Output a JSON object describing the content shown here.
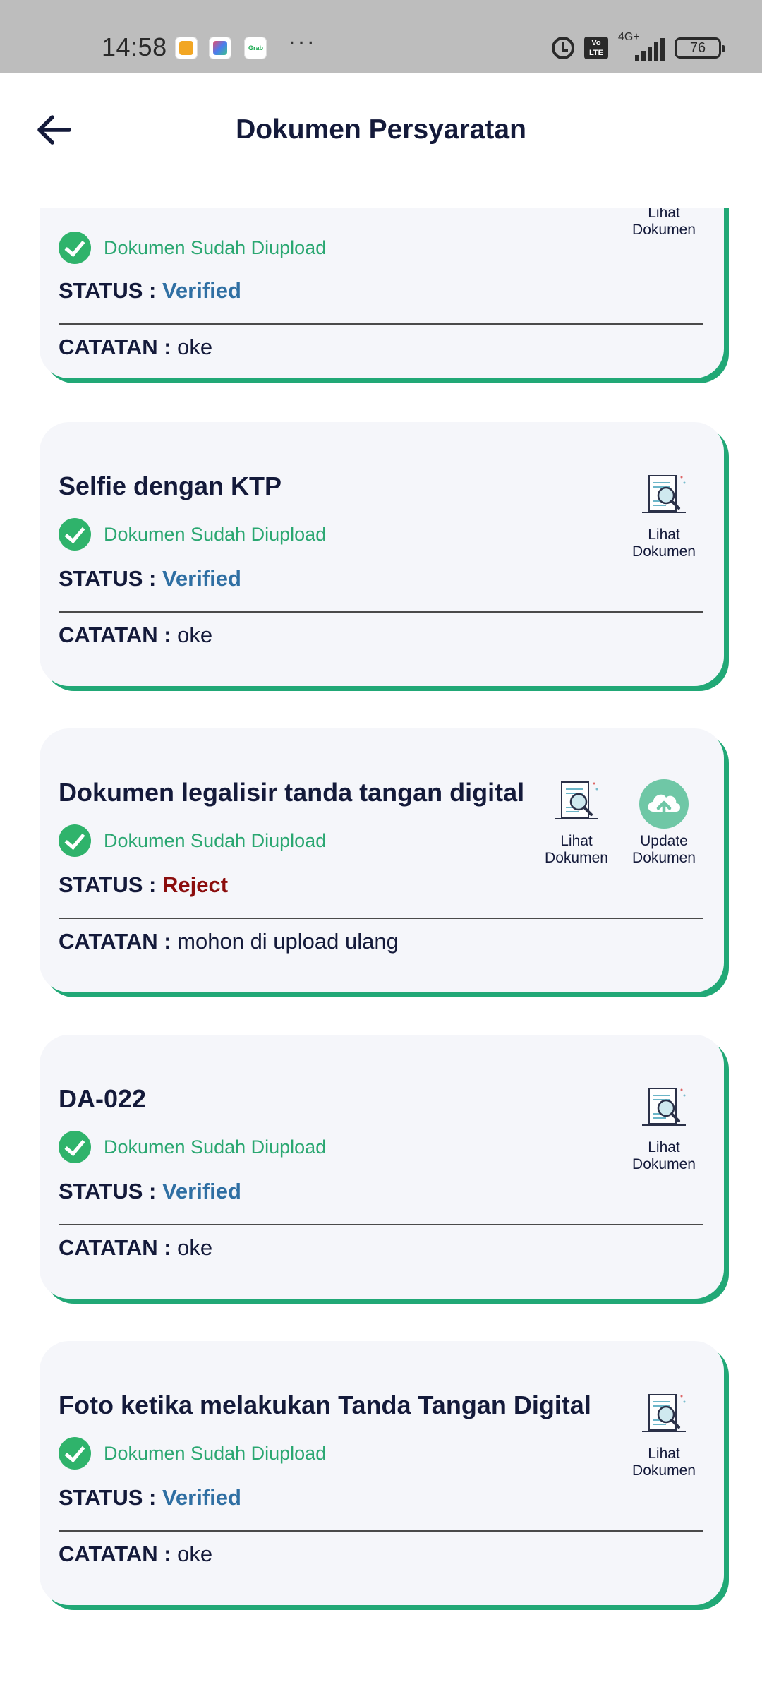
{
  "status_bar": {
    "time": "14:58",
    "network": "4G+",
    "volte": "Vo LTE",
    "battery": "76",
    "icons": [
      "shield-app-icon",
      "photo-app-icon",
      "grab-app-icon",
      "alarm-icon",
      "volte-icon",
      "signal-icon",
      "battery-icon"
    ]
  },
  "header": {
    "title": "Dokumen Persyaratan",
    "back_icon": "arrow-left-icon"
  },
  "colors": {
    "accent_green": "#21a876",
    "check_green": "#2fb36b",
    "verified_blue": "#2f6fa3",
    "reject_red": "#8b0d0d",
    "card_bg": "#f5f6fa"
  },
  "labels": {
    "uploaded": "Dokumen Sudah Diupload",
    "status": "STATUS :",
    "note": "CATATAN :",
    "view_doc_line1": "Lihat",
    "view_doc_line2": "Dokumen",
    "update_doc_line1": "Update",
    "update_doc_line2": "Dokumen"
  },
  "documents": [
    {
      "title": "",
      "status": "Verified",
      "note": "oke"
    },
    {
      "title": "Selfie dengan KTP",
      "status": "Verified",
      "note": "oke"
    },
    {
      "title": "Dokumen legalisir tanda tangan digital",
      "status": "Reject",
      "note": "mohon di upload ulang"
    },
    {
      "title": "DA-022",
      "status": "Verified",
      "note": "oke"
    },
    {
      "title": "Foto ketika melakukan Tanda Tangan Digital",
      "status": "Verified",
      "note": "oke"
    }
  ]
}
